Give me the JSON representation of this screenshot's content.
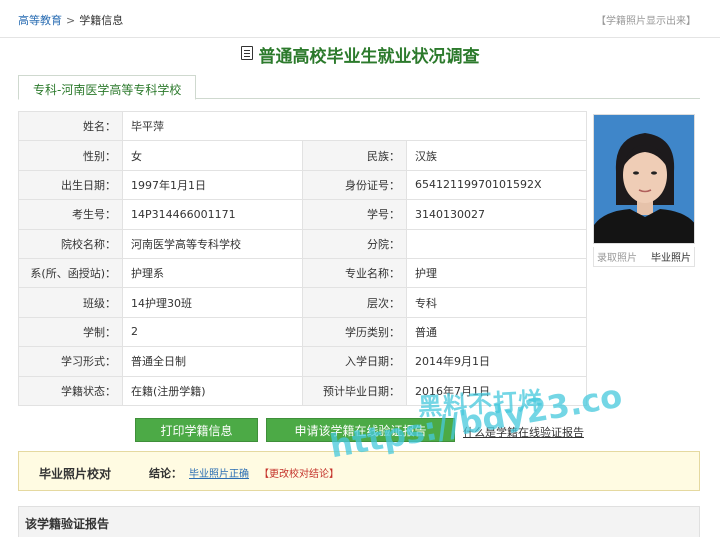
{
  "breadcrumb": {
    "home": "高等教育",
    "separator": ">",
    "current": "学籍信息"
  },
  "top_right_text": "【学籍照片显示出来】",
  "page_title": "普通高校毕业生就业状况调查",
  "tab_label": "专科-河南医学高等专科学校",
  "fields": {
    "name_label": "姓名：",
    "name": "毕平萍",
    "gender_label": "性别：",
    "gender": "女",
    "ethnicity_label": "民族：",
    "ethnicity": "汉族",
    "birth_label": "出生日期：",
    "birth": "1997年1月1日",
    "id_label": "身份证号：",
    "id_number": "65412119970101592X",
    "exam_label": "考生号：",
    "exam_no": "14P314466001171",
    "student_label": "学号：",
    "student_no": "3140130027",
    "school_label": "院校名称：",
    "school": "河南医学高等专科学校",
    "campus_label": "分院：",
    "campus": "",
    "dept_label": "系(所、函授站)：",
    "dept": "护理系",
    "major_label": "专业名称：",
    "major": "护理",
    "class_label": "班级：",
    "class": "14护理30班",
    "level_label": "层次：",
    "level": "专科",
    "duration_label": "学制：",
    "duration": "2",
    "degree_type_label": "学历类别：",
    "degree_type": "普通",
    "study_form_label": "学习形式：",
    "study_form": "普通全日制",
    "enroll_label": "入学日期：",
    "enroll_date": "2014年9月1日",
    "status_label": "学籍状态：",
    "status": "在籍(注册学籍)",
    "grad_label": "预计毕业日期：",
    "grad_date": "2016年7月1日"
  },
  "photo": {
    "enroll_caption": "录取照片",
    "grad_caption": "毕业照片"
  },
  "buttons": {
    "print": "打印学籍信息",
    "apply": "申请该学籍在线验证报告",
    "help": "什么是学籍在线验证报告"
  },
  "verify": {
    "title": "毕业照片校对",
    "result_label": "结论：",
    "result_value": "毕业照片正确",
    "change_link": "【更改校对结论】"
  },
  "report_section_title": "该学籍验证报告",
  "watermark": {
    "line1": "黑料不打烊",
    "line2": "https://bdy23.co"
  },
  "colors": {
    "accent_green": "#2c7a2c",
    "button_green": "#4caa46",
    "link_blue": "#2a6db3",
    "photo_bg": "#3f86c9"
  }
}
